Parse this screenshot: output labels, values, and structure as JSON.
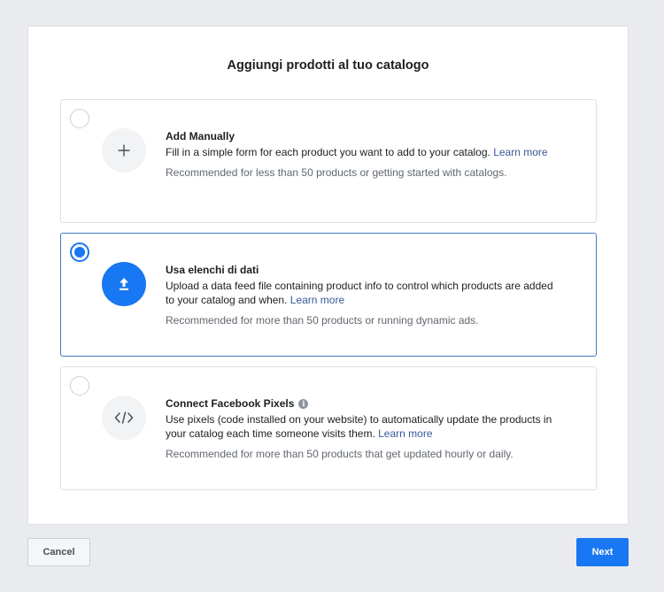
{
  "dialog": {
    "title": "Aggiungi prodotti al tuo catalogo"
  },
  "options": [
    {
      "title": "Add Manually",
      "description": "Fill in a simple form for each product you want to add to your catalog.",
      "link": "Learn more",
      "recommendation": "Recommended for less than 50 products or getting started with catalogs.",
      "icon": "plus-icon",
      "selected": false
    },
    {
      "title": "Usa elenchi di dati",
      "description": "Upload a data feed file containing product info to control which products are added to your catalog and when.",
      "link": "Learn more",
      "recommendation": "Recommended for more than 50 products or running dynamic ads.",
      "icon": "upload-icon",
      "selected": true
    },
    {
      "title": "Connect Facebook Pixels",
      "description": "Use pixels (code installed on your website) to automatically update the products in your catalog each time someone visits them.",
      "link": "Learn more",
      "recommendation": "Recommended for more than 50 products that get updated hourly or daily.",
      "icon": "code-icon",
      "selected": false
    }
  ],
  "footer": {
    "cancel_label": "Cancel",
    "next_label": "Next"
  },
  "colors": {
    "accent": "#1877f2",
    "link": "#385898",
    "selected_border": "#3b7bbf",
    "background": "#e9ebee"
  }
}
